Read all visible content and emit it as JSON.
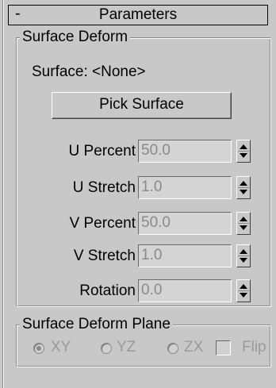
{
  "rollout": {
    "collapse_symbol": "-",
    "title": "Parameters"
  },
  "surface_deform": {
    "legend": "Surface Deform",
    "surface_label": "Surface: <None>",
    "pick_button": "Pick Surface",
    "params": [
      {
        "label": "U Percent",
        "value": "50.0"
      },
      {
        "label": "U Stretch",
        "value": "1.0"
      },
      {
        "label": "V Percent",
        "value": "50.0"
      },
      {
        "label": "V Stretch",
        "value": "1.0"
      },
      {
        "label": "Rotation",
        "value": "0.0"
      }
    ]
  },
  "deform_plane": {
    "legend": "Surface Deform Plane",
    "options": [
      {
        "label": "XY",
        "checked": true
      },
      {
        "label": "YZ",
        "checked": false
      },
      {
        "label": "ZX",
        "checked": false
      }
    ],
    "flip_label": "Flip"
  }
}
